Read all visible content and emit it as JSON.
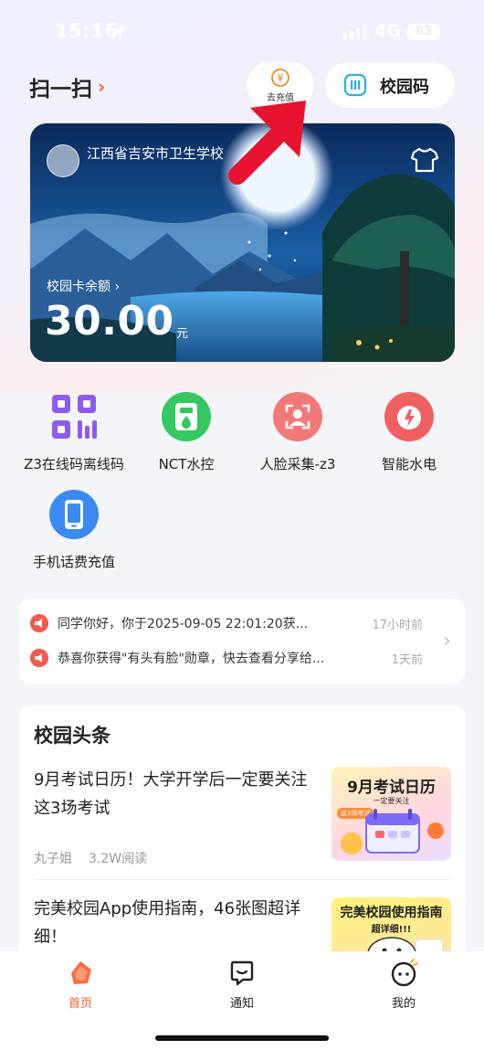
{
  "status_bar": {
    "time": "15:16",
    "network": "4G",
    "battery": "83"
  },
  "header": {
    "scan_label": "扫一扫",
    "scan_chevron": "›",
    "recharge_label": "去充值",
    "campus_code_label": "校园码"
  },
  "card": {
    "school_name": "江西省吉安市卫生学校",
    "balance_label": "校园卡余额 ›",
    "balance_value": "30.00",
    "balance_unit": "元"
  },
  "services": [
    {
      "label": "Z3在线码离线码",
      "icon": "qr-code-icon",
      "color": "#8c5cf0"
    },
    {
      "label": "NCT水控",
      "icon": "water-meter-icon",
      "color": "#33c860"
    },
    {
      "label": "人脸采集-z3",
      "icon": "face-scan-icon",
      "color": "#f26b6b"
    },
    {
      "label": "智能水电",
      "icon": "utility-icon",
      "color": "#f05555"
    },
    {
      "label": "手机话费充值",
      "icon": "phone-recharge-icon",
      "color": "#3a8af2"
    }
  ],
  "notifications": [
    {
      "text": "同学你好，你于2025-09-05 22:01:20获...",
      "time": "17小时前"
    },
    {
      "text": "恭喜你获得\"有头有脸\"勋章，快去查看分享给...",
      "time": "1天前"
    }
  ],
  "news": {
    "title": "校园头条",
    "articles": [
      {
        "title": "9月考试日历！大学开学后一定要关注这3场考试",
        "author": "丸子姐",
        "views": "3.2W阅读",
        "thumb_title": "9月考试日历",
        "thumb_sub": "一定要关注",
        "thumb_tag": "这3场考试"
      },
      {
        "title": "完美校园App使用指南，46张图超详细！",
        "thumb_title": "完美校园使用指南",
        "thumb_sub": "超详细!!!"
      }
    ]
  },
  "tabbar": {
    "tabs": [
      {
        "label": "首页",
        "active": true
      },
      {
        "label": "通知",
        "active": false
      },
      {
        "label": "我的",
        "active": false
      }
    ]
  },
  "colors": {
    "accent": "#ff5a2a",
    "notice_icon": "#f25b4c"
  }
}
